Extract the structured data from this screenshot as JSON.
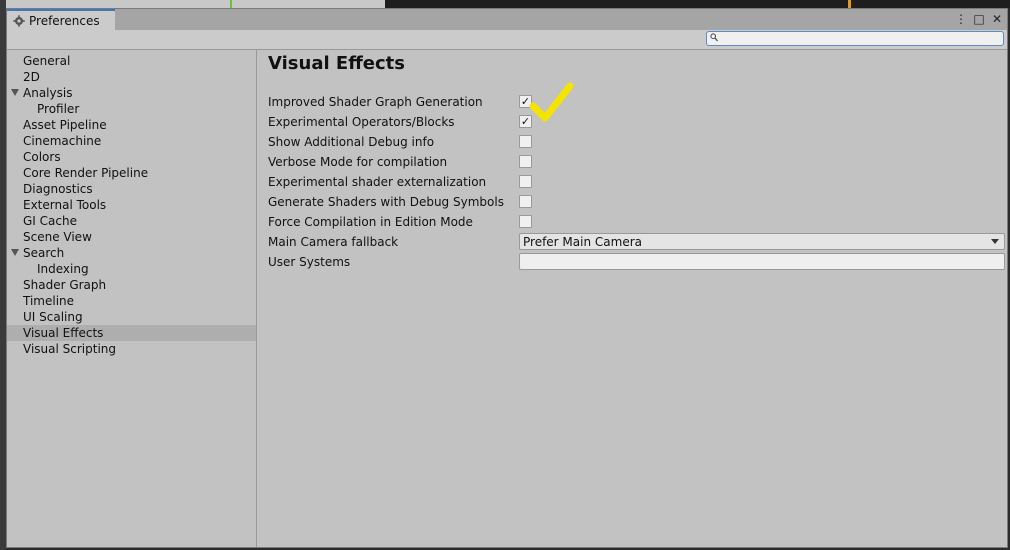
{
  "window": {
    "tab_title": "Preferences",
    "controls": {
      "menu": "⋮",
      "maximize": "□",
      "close": "✕"
    }
  },
  "search": {
    "value": "",
    "placeholder": ""
  },
  "sidebar": {
    "items": [
      {
        "label": "General",
        "level": 0
      },
      {
        "label": "2D",
        "level": 0
      },
      {
        "label": "Analysis",
        "level": 0,
        "expanded": true
      },
      {
        "label": "Profiler",
        "level": 1
      },
      {
        "label": "Asset Pipeline",
        "level": 0
      },
      {
        "label": "Cinemachine",
        "level": 0
      },
      {
        "label": "Colors",
        "level": 0
      },
      {
        "label": "Core Render Pipeline",
        "level": 0
      },
      {
        "label": "Diagnostics",
        "level": 0
      },
      {
        "label": "External Tools",
        "level": 0
      },
      {
        "label": "GI Cache",
        "level": 0
      },
      {
        "label": "Scene View",
        "level": 0
      },
      {
        "label": "Search",
        "level": 0,
        "expanded": true
      },
      {
        "label": "Indexing",
        "level": 1
      },
      {
        "label": "Shader Graph",
        "level": 0
      },
      {
        "label": "Timeline",
        "level": 0
      },
      {
        "label": "UI Scaling",
        "level": 0
      },
      {
        "label": "Visual Effects",
        "level": 0,
        "selected": true
      },
      {
        "label": "Visual Scripting",
        "level": 0
      }
    ]
  },
  "main": {
    "title": "Visual Effects",
    "settings": [
      {
        "label": "Improved Shader Graph Generation",
        "type": "checkbox",
        "checked": true
      },
      {
        "label": "Experimental Operators/Blocks",
        "type": "checkbox",
        "checked": true
      },
      {
        "label": "Show Additional Debug info",
        "type": "checkbox",
        "checked": false
      },
      {
        "label": "Verbose Mode for compilation",
        "type": "checkbox",
        "checked": false
      },
      {
        "label": "Experimental shader externalization",
        "type": "checkbox",
        "checked": false
      },
      {
        "label": "Generate Shaders with Debug Symbols",
        "type": "checkbox",
        "checked": false
      },
      {
        "label": "Force Compilation in Edition Mode",
        "type": "checkbox",
        "checked": false
      },
      {
        "label": "Main Camera fallback",
        "type": "dropdown",
        "value": "Prefer Main Camera"
      },
      {
        "label": "User Systems",
        "type": "text",
        "value": ""
      }
    ],
    "check_mark": "✓"
  },
  "colors": {
    "tab_accent": "#3a79bb",
    "annotation": "#f5e400",
    "selected_row": "#aeaeae"
  },
  "icons": {
    "tab": "gear-icon",
    "search": "magnifier-icon",
    "annotation": "yellow-checkmark-icon"
  }
}
